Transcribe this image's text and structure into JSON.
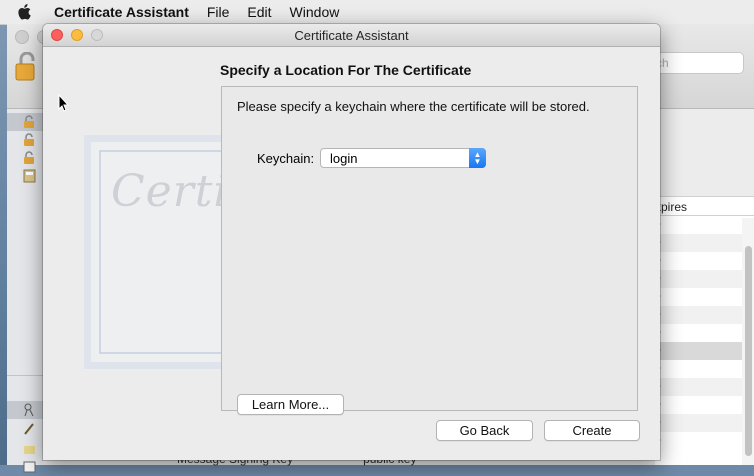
{
  "menubar": {
    "app_name": "Certificate Assistant",
    "items": [
      "File",
      "Edit",
      "Window"
    ]
  },
  "background_window": {
    "search_placeholder": "ch",
    "column_header": "xpires",
    "bottom_row": {
      "name": "Message Signing Key",
      "kind": "public key"
    }
  },
  "dialog": {
    "title": "Certificate Assistant",
    "heading": "Specify a Location For The Certificate",
    "instruction": "Please specify a keychain where the certificate will be stored.",
    "keychain_label": "Keychain:",
    "keychain_value": "login",
    "learn_more_label": "Learn More...",
    "go_back_label": "Go Back",
    "create_label": "Create",
    "certificate_art_text": "Certificate"
  },
  "colors": {
    "close": "#fc605c",
    "minimize": "#fdbc40",
    "popup_accent": "#1776f2"
  },
  "icons": [
    "apple-icon",
    "lock-icon",
    "keychain-icon",
    "certificate-icon",
    "key-icon",
    "cursor-icon",
    "stepper-icon"
  ]
}
